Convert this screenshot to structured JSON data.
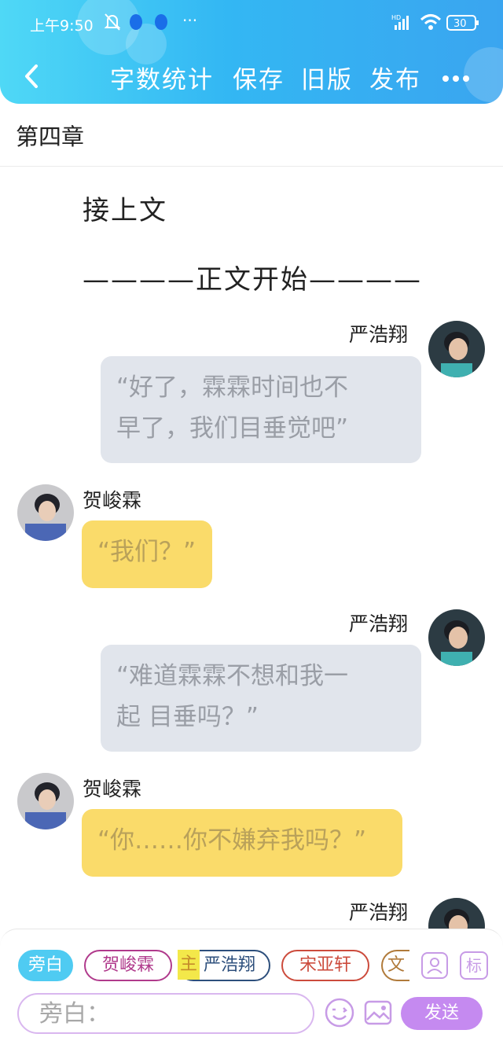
{
  "status_bar": {
    "time": "上午9:50",
    "network": "HD",
    "battery": "30"
  },
  "toolbar": {
    "word_count": "字数统计",
    "save": "保存",
    "old_version": "旧版",
    "publish": "发布"
  },
  "chapter_title": "第四章",
  "narration": [
    "接上文",
    "————正文开始————"
  ],
  "messages": [
    {
      "speaker": "严浩翔",
      "text": "“好了，霖霖时间也不早了，我们目垂觉吧”"
    },
    {
      "speaker": "贺峻霖",
      "text": "“我们？”"
    },
    {
      "speaker": "严浩翔",
      "text": "“难道霖霖不想和我一起 目垂吗？”"
    },
    {
      "speaker": "贺峻霖",
      "text": "“你……你不嫌弃我吗？”"
    },
    {
      "speaker": "严浩翔",
      "text": ""
    }
  ],
  "msg_lines": {
    "m1": [
      "“好了，霖霖时间也不",
      "早了，我们目垂觉吧”"
    ],
    "m2": [
      "“我们？”"
    ],
    "m3": [
      "“难道霖霖不想和我一",
      "起 目垂吗？”"
    ],
    "m4": [
      "“你……你不嫌弃我吗？”"
    ]
  },
  "role_chips": [
    {
      "label": "旁白",
      "active": true
    },
    {
      "label": "贺峻霖"
    },
    {
      "label": "严浩翔",
      "tag": "主"
    },
    {
      "label": "宋亚轩"
    },
    {
      "label": "文"
    }
  ],
  "input": {
    "prefix": "旁白：",
    "value": ""
  },
  "send_label": "发送",
  "icons": {
    "role_manage": "person-card-icon",
    "mark": "标"
  },
  "colors": {
    "header": "#33b7f3",
    "bubble_grey": "#e1e5ec",
    "bubble_yellow": "#fadb6a",
    "send": "#c58af0"
  }
}
